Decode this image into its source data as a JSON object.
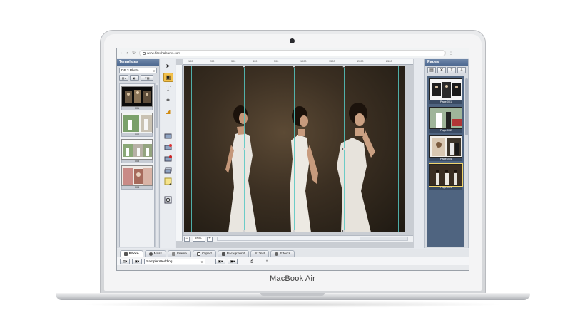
{
  "device": {
    "brand_label": "MacBook Air"
  },
  "browser": {
    "url": "www.hitechalbums.com",
    "back": "‹",
    "forward": "›",
    "reload": "↻",
    "menu": "⋮"
  },
  "templates_panel": {
    "title": "Templates",
    "selected_type": "DP 3 Photo",
    "thumbnails": [
      {
        "caption": "001"
      },
      {
        "caption": "002"
      },
      {
        "caption": "003"
      },
      {
        "caption": "004"
      }
    ]
  },
  "tools": [
    {
      "icon": "arrow-select-icon",
      "glyph": "➤"
    },
    {
      "icon": "image-tool-icon",
      "glyph": "▣"
    },
    {
      "icon": "text-tool-icon",
      "glyph": "T"
    },
    {
      "icon": "crop-tool-icon",
      "glyph": "⌗"
    },
    {
      "icon": "line-tool-icon",
      "glyph": "◢"
    }
  ],
  "ruler_marks": [
    "100",
    "200",
    "300",
    "400",
    "500",
    "1000",
    "1500",
    "2000",
    "2500"
  ],
  "zoom": {
    "value": "20%",
    "minus": "−",
    "plus": "+"
  },
  "pages_panel": {
    "title": "Pages",
    "pages": [
      {
        "caption": "Page 001"
      },
      {
        "caption": "Page 002"
      },
      {
        "caption": "Page 004"
      },
      {
        "caption": "Page 001"
      }
    ]
  },
  "bottom_tabs": [
    {
      "label": "Photo",
      "active": true
    },
    {
      "label": "Mask",
      "active": false
    },
    {
      "label": "Frame",
      "active": false
    },
    {
      "label": "Clipart",
      "active": false
    },
    {
      "label": "Background",
      "active": false
    },
    {
      "label": "Text",
      "active": false
    },
    {
      "label": "Effects",
      "active": false
    }
  ],
  "photo_bar": {
    "album_select": "Sample Wedding"
  },
  "colors": {
    "panel_header": "#5a739b",
    "guide": "#55c7c2",
    "tool_selected": "#f3c04a"
  }
}
